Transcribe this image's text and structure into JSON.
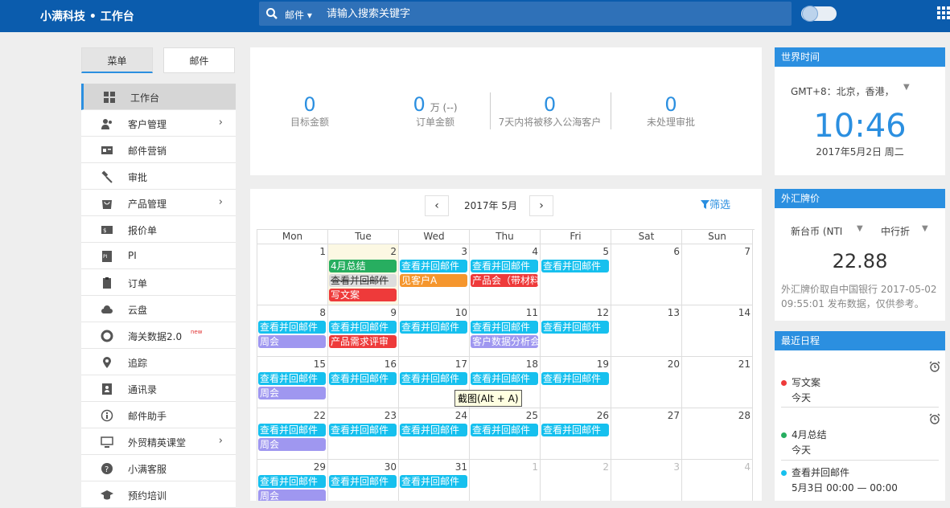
{
  "header": {
    "brand": "小满科技 • 工作台",
    "search_category": "邮件 ▾",
    "search_placeholder": "请输入搜索关键字"
  },
  "tabs": [
    "菜单",
    "邮件"
  ],
  "menu": [
    {
      "label": "工作台",
      "icon": "dashboard-icon"
    },
    {
      "label": "客户管理",
      "icon": "customers-icon",
      "chevron": "›"
    },
    {
      "label": "邮件营销",
      "icon": "mail-card-icon"
    },
    {
      "label": "审批",
      "icon": "gavel-icon"
    },
    {
      "label": "产品管理",
      "icon": "product-bag-icon",
      "chevron": "›"
    },
    {
      "label": "报价单",
      "icon": "quote-icon"
    },
    {
      "label": "PI",
      "icon": "pi-doc-icon"
    },
    {
      "label": "订单",
      "icon": "order-icon"
    },
    {
      "label": "云盘",
      "icon": "cloud-icon"
    },
    {
      "label": "海关数据2.0",
      "icon": "lifebuoy-icon",
      "badge": "new"
    },
    {
      "label": "追踪",
      "icon": "location-pin-icon"
    },
    {
      "label": "通讯录",
      "icon": "contacts-icon"
    },
    {
      "label": "邮件助手",
      "icon": "info-icon"
    },
    {
      "label": "外贸精英课堂",
      "icon": "monitor-icon",
      "chevron": "›"
    },
    {
      "label": "小满客服",
      "icon": "help-icon"
    },
    {
      "label": "预约培训",
      "icon": "graduation-icon"
    }
  ],
  "stats": {
    "target": {
      "value": "0",
      "label": "目标金额"
    },
    "order": {
      "value": "0",
      "unit": "万 (--)",
      "label": "订单金额"
    },
    "public": {
      "value": "0",
      "label": "7天内将被移入公海客户"
    },
    "approval": {
      "value": "0",
      "label": "未处理审批"
    }
  },
  "calendar": {
    "month": "2017年 5月",
    "prev": "‹",
    "next": "›",
    "filter": "筛选",
    "weekdays": [
      "Mon",
      "Tue",
      "Wed",
      "Thu",
      "Fri",
      "Sat",
      "Sun"
    ],
    "weeks": [
      [
        "1",
        "2",
        "3",
        "4",
        "5",
        "6",
        "7"
      ],
      [
        "8",
        "9",
        "10",
        "11",
        "12",
        "13",
        "14"
      ],
      [
        "15",
        "16",
        "17",
        "18",
        "19",
        "20",
        "21"
      ],
      [
        "22",
        "23",
        "24",
        "25",
        "26",
        "27",
        "28"
      ],
      [
        "29",
        "30",
        "31",
        "1",
        "2",
        "3",
        "4"
      ]
    ],
    "events": [
      {
        "w": 0,
        "d": 1,
        "r": 0,
        "text": "4月总结",
        "color": "#27ae60"
      },
      {
        "w": 0,
        "d": 1,
        "r": 1,
        "text": "查看并回邮件",
        "color": "#dddddd",
        "struck": true
      },
      {
        "w": 0,
        "d": 1,
        "r": 2,
        "text": "写文案",
        "color": "#ee3a3a"
      },
      {
        "w": 0,
        "d": 2,
        "r": 0,
        "text": "查看并回邮件",
        "color": "#16c0ee"
      },
      {
        "w": 0,
        "d": 2,
        "r": 1,
        "text": "见客户A",
        "color": "#f5962d"
      },
      {
        "w": 0,
        "d": 3,
        "r": 0,
        "text": "查看并回邮件",
        "color": "#16c0ee"
      },
      {
        "w": 0,
        "d": 3,
        "r": 1,
        "text": "产品会（带材料",
        "color": "#ee3a3a"
      },
      {
        "w": 0,
        "d": 4,
        "r": 0,
        "text": "查看并回邮件",
        "color": "#16c0ee"
      },
      {
        "w": 1,
        "d": 0,
        "r": 0,
        "text": "查看并回邮件",
        "color": "#16c0ee"
      },
      {
        "w": 1,
        "d": 0,
        "r": 1,
        "text": "周会",
        "color": "#9f97f0"
      },
      {
        "w": 1,
        "d": 1,
        "r": 0,
        "text": "查看并回邮件",
        "color": "#16c0ee"
      },
      {
        "w": 1,
        "d": 1,
        "r": 1,
        "text": "产品需求评审",
        "color": "#ee3a3a"
      },
      {
        "w": 1,
        "d": 2,
        "r": 0,
        "text": "查看并回邮件",
        "color": "#16c0ee"
      },
      {
        "w": 1,
        "d": 3,
        "r": 0,
        "text": "查看并回邮件",
        "color": "#16c0ee"
      },
      {
        "w": 1,
        "d": 3,
        "r": 1,
        "text": "客户数据分析会",
        "color": "#9f97f0"
      },
      {
        "w": 1,
        "d": 4,
        "r": 0,
        "text": "查看并回邮件",
        "color": "#16c0ee"
      },
      {
        "w": 2,
        "d": 0,
        "r": 0,
        "text": "查看并回邮件",
        "color": "#16c0ee"
      },
      {
        "w": 2,
        "d": 0,
        "r": 1,
        "text": "周会",
        "color": "#9f97f0"
      },
      {
        "w": 2,
        "d": 1,
        "r": 0,
        "text": "查看并回邮件",
        "color": "#16c0ee"
      },
      {
        "w": 2,
        "d": 2,
        "r": 0,
        "text": "查看并回邮件",
        "color": "#16c0ee"
      },
      {
        "w": 2,
        "d": 3,
        "r": 0,
        "text": "查看并回邮件",
        "color": "#16c0ee"
      },
      {
        "w": 2,
        "d": 4,
        "r": 0,
        "text": "查看并回邮件",
        "color": "#16c0ee"
      },
      {
        "w": 3,
        "d": 0,
        "r": 0,
        "text": "查看并回邮件",
        "color": "#16c0ee"
      },
      {
        "w": 3,
        "d": 0,
        "r": 1,
        "text": "周会",
        "color": "#9f97f0"
      },
      {
        "w": 3,
        "d": 1,
        "r": 0,
        "text": "查看并回邮件",
        "color": "#16c0ee"
      },
      {
        "w": 3,
        "d": 2,
        "r": 0,
        "text": "查看并回邮件",
        "color": "#16c0ee"
      },
      {
        "w": 3,
        "d": 3,
        "r": 0,
        "text": "查看并回邮件",
        "color": "#16c0ee"
      },
      {
        "w": 3,
        "d": 4,
        "r": 0,
        "text": "查看并回邮件",
        "color": "#16c0ee"
      },
      {
        "w": 4,
        "d": 0,
        "r": 0,
        "text": "查看并回邮件",
        "color": "#16c0ee"
      },
      {
        "w": 4,
        "d": 0,
        "r": 1,
        "text": "周会",
        "color": "#9f97f0"
      },
      {
        "w": 4,
        "d": 1,
        "r": 0,
        "text": "查看并回邮件",
        "color": "#16c0ee"
      },
      {
        "w": 4,
        "d": 2,
        "r": 0,
        "text": "查看并回邮件",
        "color": "#16c0ee"
      }
    ],
    "tooltip": "截图(Alt + A)"
  },
  "world_time": {
    "title": "世界时间",
    "timezone": "GMT+8：北京，香港，",
    "time": "10:46",
    "date": "2017年5月2日 周二"
  },
  "fx": {
    "title": "外汇牌价",
    "currency": "新台币 (NTI",
    "type": "中行折",
    "rate": "22.88",
    "note": "外汇牌价取自中国银行 2017-05-02 09:55:01 发布数据，仅供参考。"
  },
  "schedule": {
    "title": "最近日程",
    "items": [
      {
        "name": "写文案",
        "time": "今天",
        "color": "#ee3a3a"
      },
      {
        "name": "4月总结",
        "time": "今天",
        "color": "#27ae60"
      },
      {
        "name": "查看并回邮件",
        "time": "5月3日 00:00 — 00:00",
        "color": "#16c0ee"
      }
    ]
  }
}
